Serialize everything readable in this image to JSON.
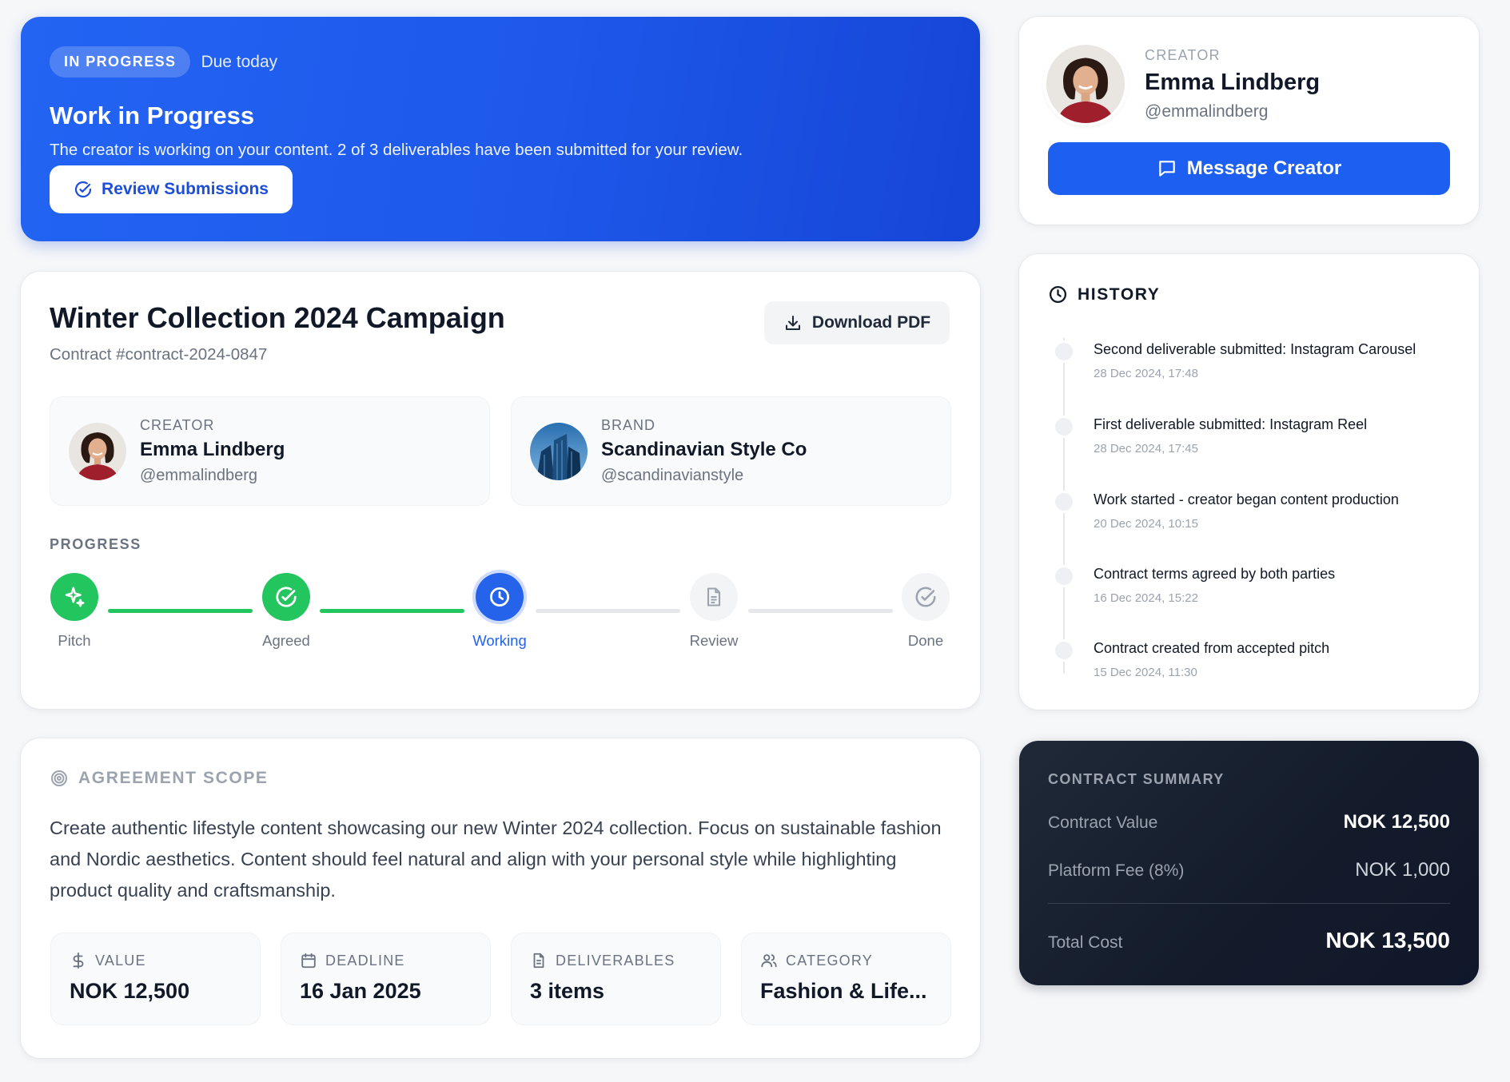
{
  "hero": {
    "status": "IN PROGRESS",
    "due": "Due today",
    "title": "Work in Progress",
    "description": "The creator is working on your content. 2 of 3 deliverables have been submitted for your review.",
    "review_button": "Review Submissions"
  },
  "contract": {
    "title": "Winter Collection 2024 Campaign",
    "id": "Contract #contract-2024-0847",
    "download_button": "Download PDF",
    "creator": {
      "label": "CREATOR",
      "name": "Emma Lindberg",
      "handle": "@emmalindberg"
    },
    "brand": {
      "label": "BRAND",
      "name": "Scandinavian Style Co",
      "handle": "@scandinavianstyle"
    },
    "progress_label": "PROGRESS",
    "steps": [
      {
        "label": "Pitch",
        "state": "done",
        "icon": "sparkles-icon"
      },
      {
        "label": "Agreed",
        "state": "done",
        "icon": "check-circle-icon"
      },
      {
        "label": "Working",
        "state": "current",
        "icon": "clock-icon"
      },
      {
        "label": "Review",
        "state": "todo",
        "icon": "document-icon"
      },
      {
        "label": "Done",
        "state": "todo",
        "icon": "check-circle-icon"
      }
    ]
  },
  "scope": {
    "heading": "AGREEMENT SCOPE",
    "text": "Create authentic lifestyle content showcasing our new Winter 2024 collection. Focus on sustainable fashion and Nordic aesthetics. Content should feel natural and align with your personal style while highlighting product quality and craftsmanship.",
    "metrics": [
      {
        "label": "VALUE",
        "value": "NOK 12,500",
        "icon": "dollar-icon"
      },
      {
        "label": "DEADLINE",
        "value": "16 Jan 2025",
        "icon": "calendar-icon"
      },
      {
        "label": "DELIVERABLES",
        "value": "3 items",
        "icon": "document-icon"
      },
      {
        "label": "CATEGORY",
        "value": "Fashion & Life...",
        "icon": "users-icon"
      }
    ]
  },
  "creator_card": {
    "label": "CREATOR",
    "name": "Emma Lindberg",
    "handle": "@emmalindberg",
    "message_button": "Message Creator"
  },
  "history": {
    "heading": "HISTORY",
    "items": [
      {
        "text": "Second deliverable submitted: Instagram Carousel",
        "time": "28 Dec 2024, 17:48"
      },
      {
        "text": "First deliverable submitted: Instagram Reel",
        "time": "28 Dec 2024, 17:45"
      },
      {
        "text": "Work started - creator began content production",
        "time": "20 Dec 2024, 10:15"
      },
      {
        "text": "Contract terms agreed by both parties",
        "time": "16 Dec 2024, 15:22"
      },
      {
        "text": "Contract created from accepted pitch",
        "time": "15 Dec 2024, 11:30"
      }
    ]
  },
  "summary": {
    "title": "CONTRACT SUMMARY",
    "rows": [
      {
        "label": "Contract Value",
        "value": "NOK 12,500"
      },
      {
        "label": "Platform Fee (8%)",
        "value": "NOK 1,000"
      },
      {
        "label": "Total Cost",
        "value": "NOK 13,500"
      }
    ]
  },
  "colors": {
    "primary": "#2563eb",
    "success": "#22c55e",
    "dark": "#111827"
  }
}
